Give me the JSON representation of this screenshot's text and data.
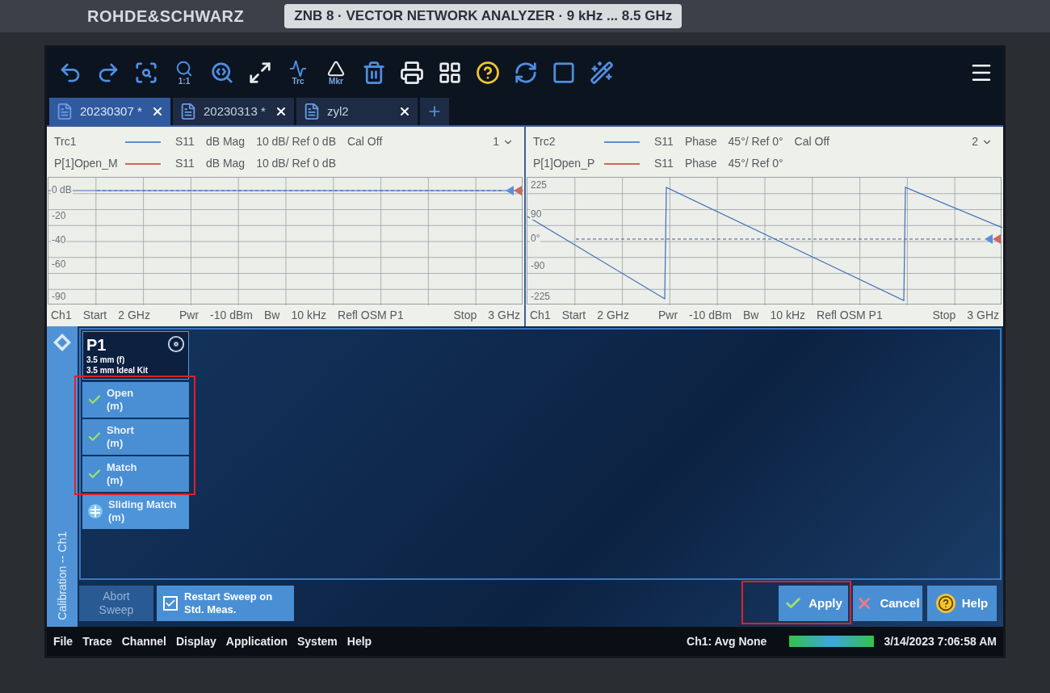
{
  "bezel": {
    "brand": "ROHDE&SCHWARZ",
    "model": "ZNB 8 · VECTOR NETWORK ANALYZER · 9 kHz ... 8.5 GHz"
  },
  "toolbar": {
    "tools": [
      {
        "kind": "undo"
      },
      {
        "kind": "redo"
      },
      {
        "kind": "zoom-area"
      },
      {
        "kind": "zoom-reset",
        "label": "1:1"
      },
      {
        "kind": "zoom-config"
      },
      {
        "kind": "fullscreen"
      },
      {
        "kind": "add-trace",
        "label": "Trc"
      },
      {
        "kind": "add-marker",
        "label": "Mkr"
      },
      {
        "kind": "delete"
      },
      {
        "kind": "print"
      },
      {
        "kind": "windows"
      },
      {
        "kind": "help"
      },
      {
        "kind": "restart"
      },
      {
        "kind": "display"
      },
      {
        "kind": "wizard"
      }
    ]
  },
  "tabs": [
    {
      "label": "20230307 *",
      "selected": true
    },
    {
      "label": "20230313 *",
      "selected": false
    },
    {
      "label": "zyl2",
      "selected": false
    }
  ],
  "diagrams": [
    {
      "number": "1",
      "traces": [
        {
          "name": "Trc1",
          "color": "#5b8fd6",
          "fields": [
            "S11",
            "dB Mag",
            "10 dB/ Ref 0 dB",
            "Cal Off"
          ]
        },
        {
          "name": "P[1]Open_M",
          "color": "#d0675f",
          "fields": [
            "S11",
            "dB Mag",
            "10 dB/ Ref 0 dB"
          ]
        }
      ],
      "channel_line": [
        "Ch1",
        "Start",
        "2 GHz",
        "Pwr",
        "-10 dBm",
        "Bw",
        "10 kHz",
        "Refl OSM P1",
        "Stop",
        "3 GHz"
      ],
      "kind": "magnitude",
      "axis_labels": [
        "0 dB",
        "-20",
        "-40",
        "-60",
        "-90"
      ]
    },
    {
      "number": "2",
      "traces": [
        {
          "name": "Trc2",
          "color": "#5b8fd6",
          "fields": [
            "S11",
            "Phase",
            "45°/ Ref 0°",
            "Cal Off"
          ]
        },
        {
          "name": "P[1]Open_P",
          "color": "#d0675f",
          "fields": [
            "S11",
            "Phase",
            "45°/ Ref 0°"
          ]
        }
      ],
      "channel_line": [
        "Ch1",
        "Start",
        "2 GHz",
        "Pwr",
        "-10 dBm",
        "Bw",
        "10 kHz",
        "Refl OSM P1",
        "Stop",
        "3 GHz"
      ],
      "kind": "phase",
      "axis_labels": [
        "225",
        "90",
        "0°",
        "-90",
        "-225"
      ]
    }
  ],
  "calibration": {
    "title": "Calibration -- Ch1",
    "port": {
      "name": "P1",
      "connector": "3.5 mm (f)",
      "kit": "3.5 mm Ideal Kit"
    },
    "standards": [
      {
        "kind": "measured",
        "name": "Open",
        "gender": "(m)",
        "done": true
      },
      {
        "kind": "measured",
        "name": "Short",
        "gender": "(m)",
        "done": true
      },
      {
        "kind": "measured",
        "name": "Match",
        "gender": "(m)",
        "done": true
      },
      {
        "kind": "sliding",
        "name": "Sliding Match",
        "gender": "(m)",
        "done": false
      }
    ],
    "abort": {
      "label": "Abort Sweep",
      "disabled": true
    },
    "restart": {
      "label": "Restart Sweep on Std. Meas.",
      "checked": true
    },
    "actions": [
      {
        "kind": "apply",
        "label": "Apply"
      },
      {
        "kind": "cancel",
        "label": "Cancel"
      },
      {
        "kind": "help",
        "label": "Help"
      }
    ]
  },
  "menu": [
    "File",
    "Trace",
    "Channel",
    "Display",
    "Application",
    "System",
    "Help"
  ],
  "status": {
    "averaging": "Ch1: Avg None",
    "datetime": "3/14/2023 7:06:58 AM"
  }
}
